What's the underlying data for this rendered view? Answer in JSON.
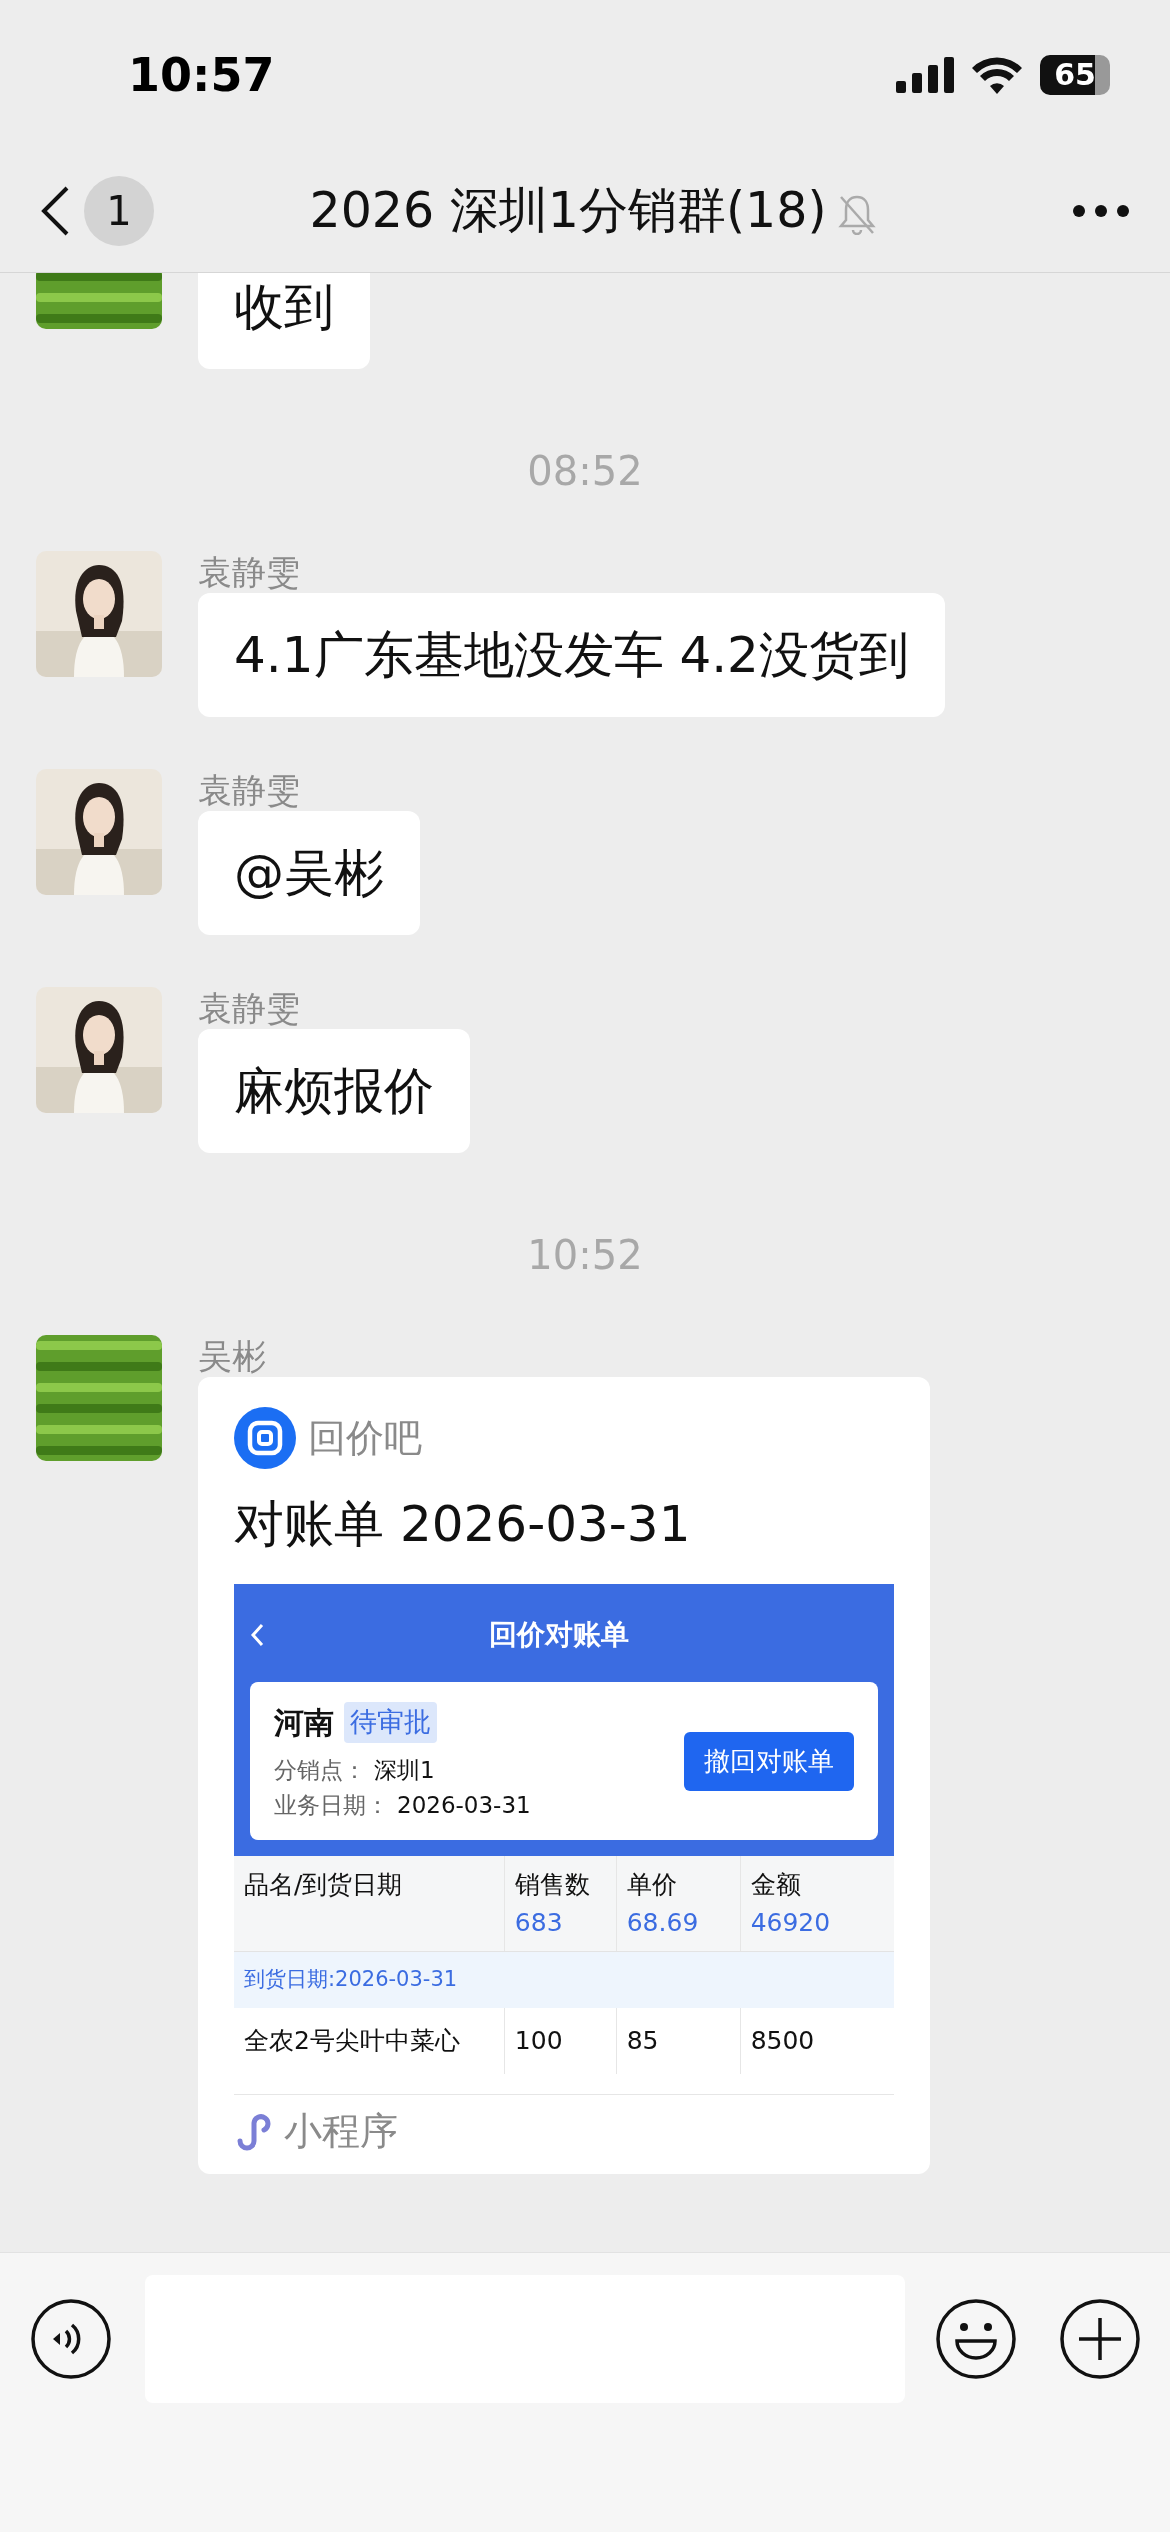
{
  "status_bar": {
    "time": "10:57",
    "battery": "65"
  },
  "header": {
    "unread_count": "1",
    "title": "2026 深圳1分销群(18)",
    "muted": true
  },
  "chat": [
    {
      "kind": "text",
      "text": "收到"
    },
    {
      "kind": "time",
      "text": "08:52"
    },
    {
      "kind": "text",
      "sender": "袁静雯",
      "text": "4.1广东基地没发车 4.2没货到"
    },
    {
      "kind": "text",
      "sender": "袁静雯",
      "text": "@吴彬"
    },
    {
      "kind": "text",
      "sender": "袁静雯",
      "text": "麻烦报价"
    },
    {
      "kind": "time",
      "text": "10:52"
    },
    {
      "kind": "card",
      "sender": "吴彬",
      "card": {
        "app_name": "回价吧",
        "title": "对账单 2026-03-31",
        "preview": {
          "page_title": "回价对账单",
          "region": "河南",
          "status": "待审批",
          "fields": [
            {
              "label": "分销点：",
              "value": "深圳1"
            },
            {
              "label": "业务日期：",
              "value": "2026-03-31"
            }
          ],
          "action": "撤回对账单",
          "columns": [
            {
              "title": "品名/到货日期"
            },
            {
              "title": "销售数",
              "total": "683"
            },
            {
              "title": "单价",
              "total": "68.69"
            },
            {
              "title": "金额",
              "total": "46920"
            }
          ],
          "groups": [
            {
              "label": "到货日期:2026-03-31",
              "rows": [
                [
                  "全农2号尖叶中菜心",
                  "100",
                  "85",
                  "8500"
                ]
              ]
            }
          ]
        },
        "footer": "小程序"
      }
    }
  ]
}
